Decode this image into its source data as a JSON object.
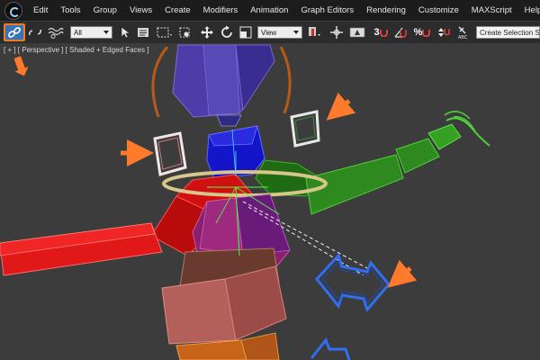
{
  "menu": {
    "items": [
      "Edit",
      "Tools",
      "Group",
      "Views",
      "Create",
      "Modifiers",
      "Animation",
      "Graph Editors",
      "Rendering",
      "Customize",
      "MAXScript",
      "Help"
    ]
  },
  "toolbar": {
    "selection_filter": "All",
    "view_dropdown": "View",
    "selection_set_placeholder": "Create Selection Se",
    "snap_label": "3",
    "percent_label": "%"
  },
  "viewport": {
    "label": "[ + ] [ Perspective ] [ Shaded + Edged Faces ]"
  },
  "colors": {
    "accent_highlight": "#f07c1e",
    "active_tool": "#3a73b8",
    "viewport_bg": "#3c3c3c"
  }
}
